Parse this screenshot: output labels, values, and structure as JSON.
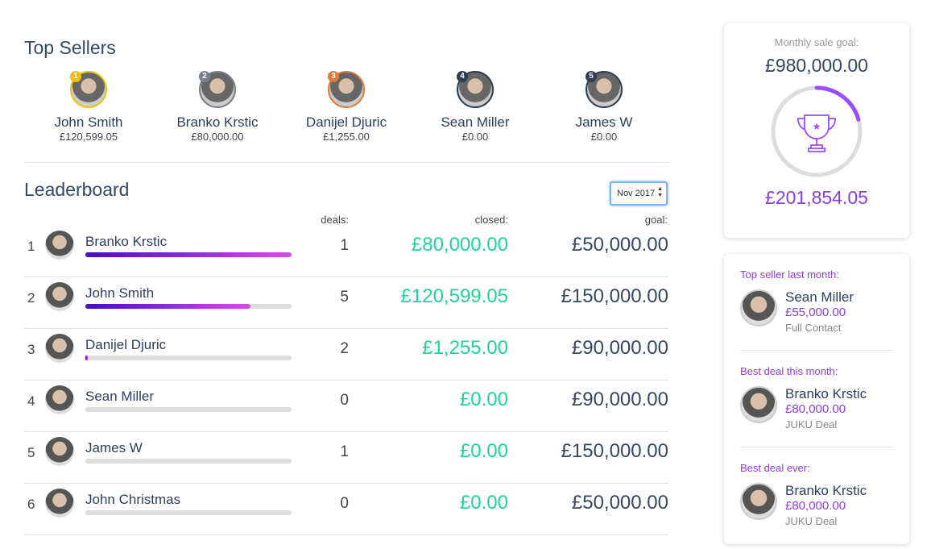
{
  "top_sellers": {
    "title": "Top Sellers",
    "items": [
      {
        "rank": "1",
        "name": "John Smith",
        "amount": "£120,599.05",
        "color": "#f2c200"
      },
      {
        "rank": "2",
        "name": "Branko Krstic",
        "amount": "£80,000.00",
        "color": "#7a7f87"
      },
      {
        "rank": "3",
        "name": "Danijel Djuric",
        "amount": "£1,255.00",
        "color": "#e07b39"
      },
      {
        "rank": "4",
        "name": "Sean Miller",
        "amount": "£0.00",
        "color": "#2c3e50"
      },
      {
        "rank": "5",
        "name": "James W",
        "amount": "£0.00",
        "color": "#2c3e50"
      }
    ]
  },
  "leaderboard": {
    "title": "Leaderboard",
    "period": "Nov 2017",
    "headers": {
      "deals": "deals:",
      "closed": "closed:",
      "goal": "goal:"
    },
    "rows": [
      {
        "rank": "1",
        "name": "Branko Krstic",
        "progress": 100,
        "deals": "1",
        "closed": "£80,000.00",
        "goal": "£50,000.00"
      },
      {
        "rank": "2",
        "name": "John Smith",
        "progress": 80,
        "deals": "5",
        "closed": "£120,599.05",
        "goal": "£150,000.00"
      },
      {
        "rank": "3",
        "name": "Danijel Djuric",
        "progress": 1,
        "deals": "2",
        "closed": "£1,255.00",
        "goal": "£90,000.00"
      },
      {
        "rank": "4",
        "name": "Sean Miller",
        "progress": 0,
        "deals": "0",
        "closed": "£0.00",
        "goal": "£90,000.00"
      },
      {
        "rank": "5",
        "name": "James W",
        "progress": 0,
        "deals": "1",
        "closed": "£0.00",
        "goal": "£150,000.00"
      },
      {
        "rank": "6",
        "name": "John Christmas",
        "progress": 0,
        "deals": "0",
        "closed": "£0.00",
        "goal": "£50,000.00"
      }
    ]
  },
  "goal_card": {
    "label": "Monthly sale goal:",
    "goal": "£980,000.00",
    "achieved": "£201,854.05",
    "progress_fraction": 0.206,
    "icon": "trophy-icon"
  },
  "highlights": [
    {
      "label": "Top seller last month:",
      "name": "Sean Miller",
      "amount": "£55,000.00",
      "sub": "Full Contact"
    },
    {
      "label": "Best deal this month:",
      "name": "Branko Krstic",
      "amount": "£80,000.00",
      "sub": "JUKU Deal"
    },
    {
      "label": "Best deal ever:",
      "name": "Branko Krstic",
      "amount": "£80,000.00",
      "sub": "JUKU Deal"
    }
  ]
}
